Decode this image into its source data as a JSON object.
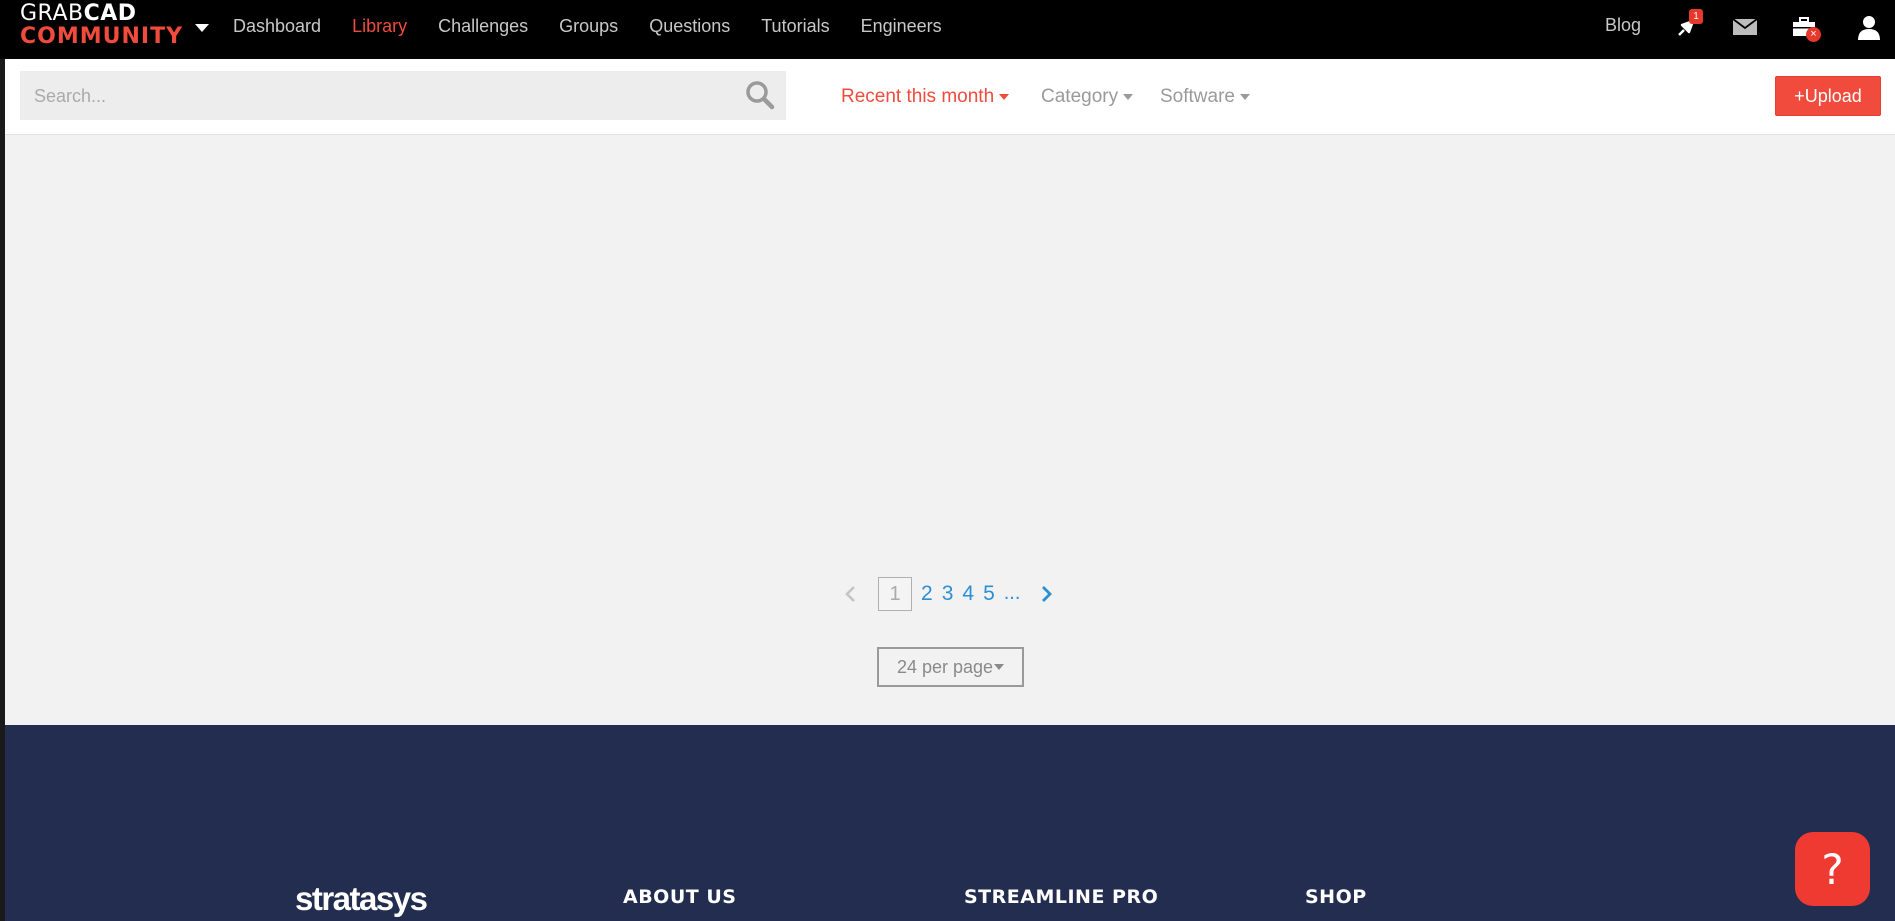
{
  "logo": {
    "line1_light": "GRAB",
    "line1_bold": "CAD",
    "line2": "COMMUNITY"
  },
  "nav": {
    "items": [
      {
        "label": "Dashboard",
        "active": false
      },
      {
        "label": "Library",
        "active": true
      },
      {
        "label": "Challenges",
        "active": false
      },
      {
        "label": "Groups",
        "active": false
      },
      {
        "label": "Questions",
        "active": false
      },
      {
        "label": "Tutorials",
        "active": false
      },
      {
        "label": "Engineers",
        "active": false
      }
    ],
    "blog": "Blog",
    "notifications_count": "1",
    "cart_badge": "×",
    "icons": [
      "notification-bell-icon",
      "mail-icon",
      "briefcase-icon",
      "user-icon"
    ]
  },
  "search": {
    "placeholder": "Search...",
    "value": ""
  },
  "filters": {
    "recent": "Recent this month",
    "category": "Category",
    "software": "Software"
  },
  "upload_label": "+Upload",
  "pagination": {
    "current": "1",
    "pages": [
      "2",
      "3",
      "4",
      "5"
    ],
    "ellipsis": "..."
  },
  "per_page": "24 per page",
  "footer": {
    "brand": "stratasys",
    "headings": [
      "ABOUT US",
      "STREAMLINE PRO",
      "SHOP"
    ]
  },
  "help_label": "?",
  "colors": {
    "accent": "#f04b3c",
    "link": "#2b8fd6",
    "footer_bg": "#232d4f",
    "topbar_bg": "#000000"
  }
}
